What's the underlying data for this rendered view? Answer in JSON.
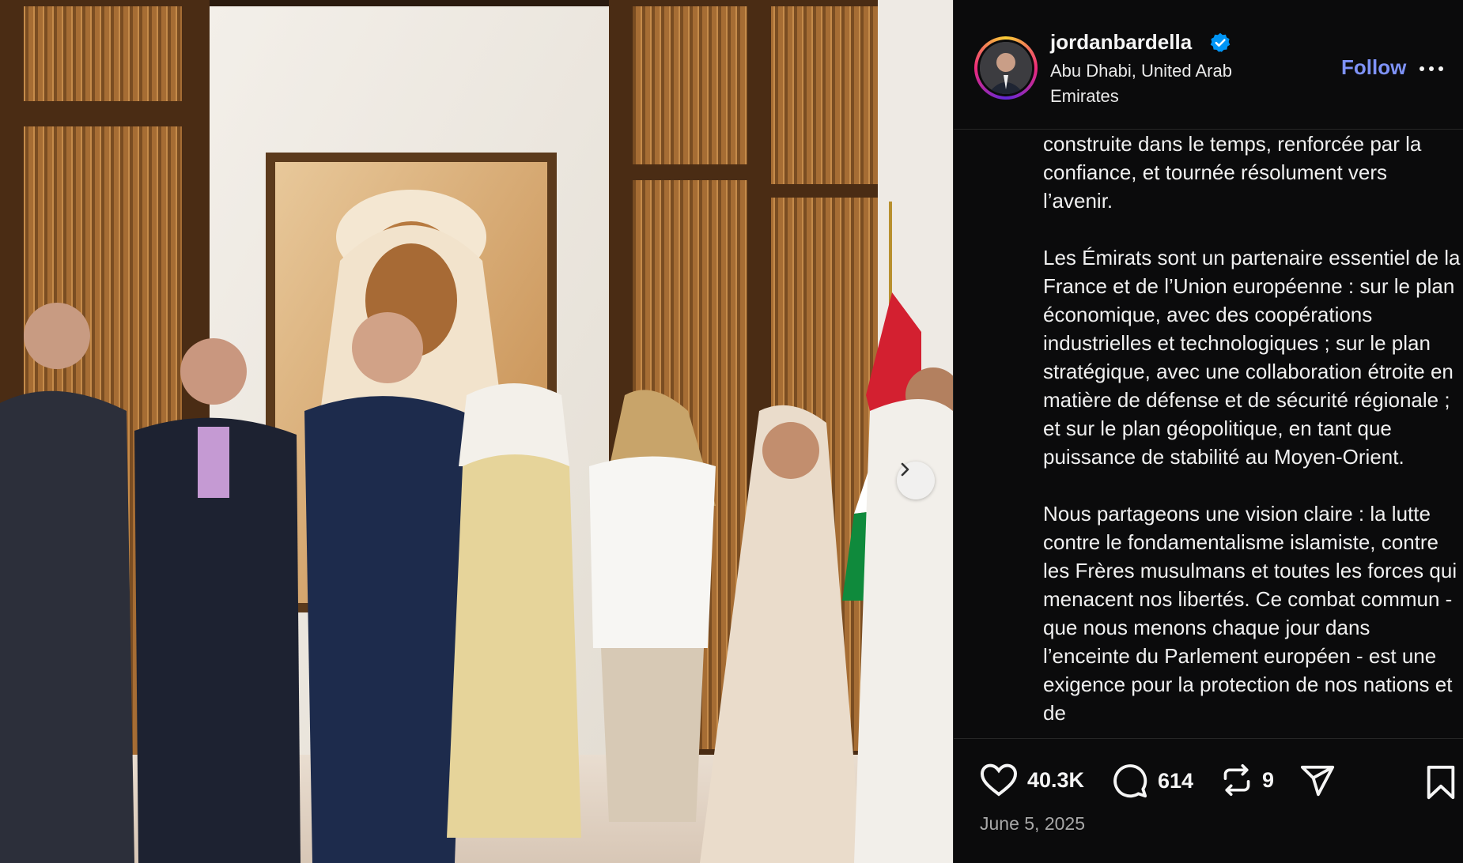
{
  "post": {
    "username": "jordanbardella",
    "location": "Abu Dhabi, United Arab Emirates",
    "follow_label": "Follow",
    "caption": "construite dans le temps, renforcée par la confiance, et tournée résolument vers l’avenir.\n\nLes Émirats sont un partenaire essentiel de la France et de l’Union européenne : sur le plan économique, avec des coopérations industrielles et technologiques ; sur le plan stratégique, avec une collaboration étroite en matière de défense et de sécurité régionale ; et sur le plan géopolitique, en tant que puissance de stabilité au Moyen-Orient.\n\nNous partageons une vision claire : la lutte contre le fondamentalisme islamiste, contre les Frères musulmans et toutes les forces qui menacent nos libertés. Ce combat commun - que nous menons chaque jour dans l’enceinte du Parlement européen - est une exigence pour la protection de nos nations et de",
    "likes": "40.3K",
    "comments": "614",
    "reposts": "9",
    "date": "June 5, 2025"
  },
  "icons": {
    "verified": "verified-badge-icon",
    "more": "more-options-icon",
    "like": "heart-icon",
    "comment": "comment-icon",
    "repost": "repost-icon",
    "share": "share-icon",
    "save": "bookmark-icon",
    "next": "chevron-right-icon"
  },
  "colors": {
    "follow": "#7e92f7",
    "verified": "#0095f6",
    "background": "#0b0b0c",
    "muted": "#a8a8a8"
  }
}
